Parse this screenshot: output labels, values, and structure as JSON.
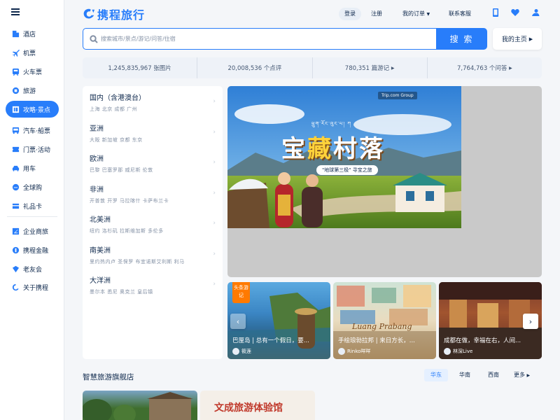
{
  "brand": {
    "name": "携程旅行",
    "accent": "#287dfa"
  },
  "sidebar": {
    "items": [
      {
        "label": "酒店",
        "icon": "hotel-icon"
      },
      {
        "label": "机票",
        "icon": "plane-icon"
      },
      {
        "label": "火车票",
        "icon": "train-icon"
      },
      {
        "label": "旅游",
        "icon": "travel-icon"
      },
      {
        "label": "攻略·景点",
        "icon": "guide-icon",
        "active": true
      },
      {
        "label": "汽车·船票",
        "icon": "bus-icon"
      },
      {
        "label": "门票·活动",
        "icon": "ticket-icon"
      },
      {
        "label": "用车",
        "icon": "car-icon"
      },
      {
        "label": "全球购",
        "icon": "global-icon"
      },
      {
        "label": "礼品卡",
        "icon": "giftcard-icon"
      },
      {
        "label": "企业商旅",
        "icon": "business-icon"
      },
      {
        "label": "携程金融",
        "icon": "finance-icon"
      },
      {
        "label": "老友会",
        "icon": "club-icon"
      },
      {
        "label": "关于携程",
        "icon": "about-icon"
      }
    ]
  },
  "header": {
    "login": "登录",
    "register": "注册",
    "orders": "我的订单",
    "service": "联系客服",
    "icons": [
      "phone-icon",
      "heart-icon",
      "user-icon"
    ]
  },
  "search": {
    "placeholder": "搜索城市/景点/游记/问答/住宿",
    "button": "搜 索",
    "home": "我的主页"
  },
  "stats": [
    "1,245,835,967 张图片",
    "20,008,536 个点评",
    "780,351 篇游记",
    "7,764,763 个问答"
  ],
  "regions": [
    {
      "name": "国内（含港澳台）",
      "cities": "上海  北京  成都  广州"
    },
    {
      "name": "亚洲",
      "cities": "大阪  新加坡  京都  东京"
    },
    {
      "name": "欧洲",
      "cities": "巴黎  巴塞罗那  威尼斯  伦敦"
    },
    {
      "name": "非洲",
      "cities": "开普敦  开罗  马拉喀什  卡萨布兰卡"
    },
    {
      "name": "北美洲",
      "cities": "纽约  洛杉矶  拉斯维加斯  多伦多"
    },
    {
      "name": "南美洲",
      "cities": "里约热内卢  圣保罗  布宜诺斯艾利斯  利马"
    },
    {
      "name": "大洋洲",
      "cities": "墨尔本  悉尼  奥克兰  皇后镇"
    }
  ],
  "banner": {
    "title_a": "宝",
    "title_b": "藏",
    "title_c": "村落",
    "subtitle": "ཕྲུག་རོང་ལུང་པ། ཀ",
    "tag": "\"地球第三极\" 寻宝之旅",
    "brand": "Trip.com Group"
  },
  "cards": [
    {
      "caption": "巴厘岛 | 总有一个假日，要...",
      "author": "筱莲",
      "badge": "头条游记"
    },
    {
      "caption": "手绘琅勃拉邦 | 来日方长，...",
      "author": "Rinko咩咩",
      "watermark": "Luang Prabang"
    },
    {
      "caption": "成都在做，幸福在右，人间...",
      "author": "林深Live"
    }
  ],
  "section": {
    "title": "智慧旅游旗舰店",
    "tabs": [
      "华东",
      "华南",
      "西南",
      "更多"
    ]
  },
  "shops": [
    {
      "label": ""
    },
    {
      "label": "文成旅游体验馆"
    }
  ]
}
